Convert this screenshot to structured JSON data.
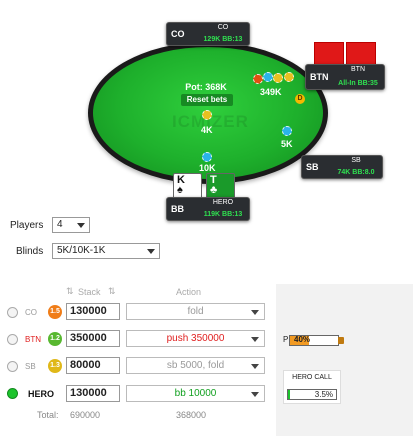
{
  "table": {
    "watermark": "ICMIZER",
    "pot_label": "Pot: 368K",
    "reset_label": "Reset bets",
    "dealer_label": "D",
    "bets": {
      "btn": "349K",
      "co": "4K",
      "sb": "5K",
      "bb": "10K"
    }
  },
  "seats": {
    "co": {
      "pos": "CO",
      "name": "CO",
      "stack": "129K BB:13"
    },
    "btn": {
      "pos": "BTN",
      "name": "BTN",
      "stack": "All-In BB:35"
    },
    "sb": {
      "pos": "SB",
      "name": "SB",
      "stack": "74K BB:8.0"
    },
    "bb": {
      "pos": "BB",
      "name": "HERO",
      "stack": "119K BB:13"
    }
  },
  "hero_cards": [
    {
      "rank": "K",
      "suit": "♠"
    },
    {
      "rank": "T",
      "suit": "♣"
    }
  ],
  "controls": {
    "players_label": "Players",
    "players_value": "4",
    "blinds_label": "Blinds",
    "blinds_value": "5K/10K-1K"
  },
  "grid": {
    "stack_header": "Stack",
    "action_header": "Action",
    "rows": [
      {
        "pos": "CO",
        "badge": "1.5",
        "badge_color": "#f07d18",
        "stack": "130000",
        "action": "fold",
        "action_color": "#999999",
        "selected": false
      },
      {
        "pos": "BTN",
        "badge": "1.2",
        "badge_color": "#58b830",
        "stack": "350000",
        "action": "push 350000",
        "action_color": "#e02020",
        "selected": false
      },
      {
        "pos": "SB",
        "badge": "1.3",
        "badge_color": "#e0b818",
        "stack": "80000",
        "action": "sb 5000, fold",
        "action_color": "#999999",
        "selected": false
      },
      {
        "pos": "HERO",
        "badge": "",
        "badge_color": "",
        "stack": "130000",
        "action": "bb 10000",
        "action_color": "#12a020",
        "selected": true
      }
    ],
    "total_label": "Total:",
    "total_stack": "690000",
    "total_action": "368000"
  },
  "panel": {
    "p_label": "P",
    "p_value": "40%",
    "p_fraction": 0.4,
    "hero_call_title": "HERO CALL",
    "hero_call_value": "3.5%",
    "hero_call_fraction": 0.035
  }
}
